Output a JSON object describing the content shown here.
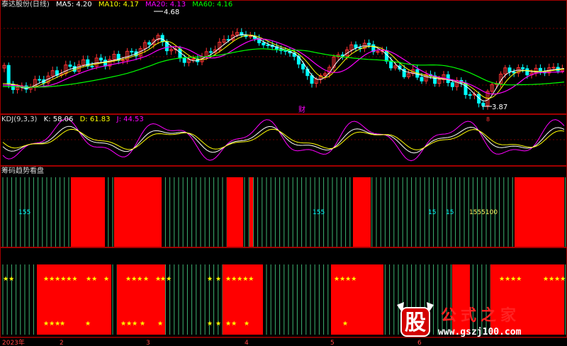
{
  "colors": {
    "bg": "#000000",
    "up": "#ff3333",
    "down": "#00ffff",
    "ma5": "#ffffff",
    "ma10": "#ffff00",
    "ma20": "#ff00ff",
    "ma60": "#00ff00",
    "grid": "#8b0000",
    "panel_border": "#a00000",
    "green_bar": "#3cb371",
    "red_block": "#ff0000",
    "star": "#ffff00"
  },
  "price_panel": {
    "title": "泰达股份(日线)",
    "ma5": "MA5: 4.20",
    "ma10": "MA10: 4.17",
    "ma20": "MA20: 4.13",
    "ma60": "MA60: 4.16",
    "high_mark": "4.68",
    "low_mark": "3.87",
    "event_mark": "财",
    "small_mark": "8"
  },
  "kdj_panel": {
    "title": "KDJ(9,3,3)",
    "k": "K: 58.06",
    "d": "D: 61.83",
    "j": "J: 44.53"
  },
  "trend_panel": {
    "title": "筹码趋势看盘",
    "numbers": [
      "155",
      "155",
      "15",
      "15",
      "1555100"
    ]
  },
  "star_panel": {
    "top_stars": [
      "★★",
      "★★★★★★",
      "★★",
      "★",
      "★★★",
      "★",
      "★",
      "★★",
      "★",
      "★",
      "★★★★★",
      "★★★★",
      "★★★★",
      "★★★★"
    ],
    "bottom_stars": [
      "★★★",
      "★",
      "★",
      "★★★",
      "★",
      "★",
      "★",
      "★",
      "★★",
      "★",
      "★"
    ]
  },
  "x_axis": {
    "labels": [
      "2023年",
      "2",
      "3",
      "4",
      "5",
      "6"
    ]
  },
  "watermark": {
    "glyph": "股",
    "text": "公式之家",
    "url": "www.gszj100.com"
  },
  "chart_data": [
    {
      "type": "candlestick",
      "title": "泰达股份(日线)",
      "series": [
        {
          "name": "MA5",
          "last": 4.2
        },
        {
          "name": "MA10",
          "last": 4.17
        },
        {
          "name": "MA20",
          "last": 4.13
        },
        {
          "name": "MA60",
          "last": 4.16
        }
      ],
      "annotations": {
        "high": 4.68,
        "low": 3.87
      }
    },
    {
      "type": "line",
      "title": "KDJ(9,3,3)",
      "series": [
        {
          "name": "K",
          "last": 58.06
        },
        {
          "name": "D",
          "last": 61.83
        },
        {
          "name": "J",
          "last": 44.53
        }
      ]
    }
  ]
}
